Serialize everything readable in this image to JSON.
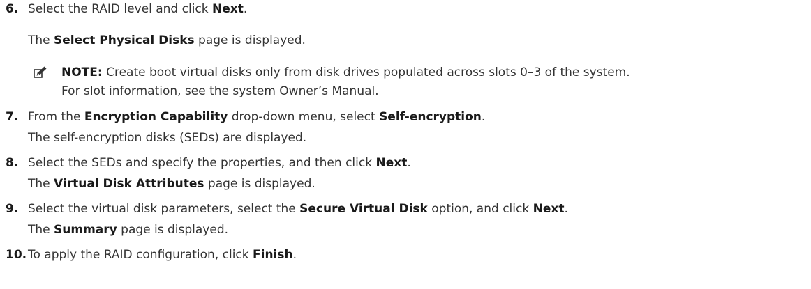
{
  "steps": [
    {
      "number": "6.",
      "instruction": [
        "Select the RAID level and click ",
        "Next",
        "."
      ],
      "result": [
        "The ",
        "Select Physical Disks",
        " page is displayed."
      ],
      "note": {
        "label": "NOTE:",
        "line1": " Create boot virtual disks only from disk drives populated across slots 0–3 of the system.",
        "line2": "For slot information, see the system Owner’s Manual.",
        "icon": "note-pencil-icon"
      }
    },
    {
      "number": "7.",
      "instruction": [
        "From the ",
        "Encryption Capability",
        " drop-down menu, select ",
        "Self-encryption",
        "."
      ],
      "result": [
        "The self-encryption disks (SEDs) are displayed."
      ]
    },
    {
      "number": "8.",
      "instruction": [
        "Select the SEDs and specify the properties, and then click ",
        "Next",
        "."
      ],
      "result": [
        "The ",
        "Virtual Disk Attributes",
        " page is displayed."
      ]
    },
    {
      "number": "9.",
      "instruction": [
        "Select the virtual disk parameters, select the ",
        "Secure Virtual Disk",
        " option, and click ",
        "Next",
        "."
      ],
      "result": [
        "The ",
        "Summary",
        " page is displayed."
      ]
    },
    {
      "number": "10.",
      "instruction": [
        "To apply the RAID configuration, click ",
        "Finish",
        "."
      ]
    }
  ]
}
